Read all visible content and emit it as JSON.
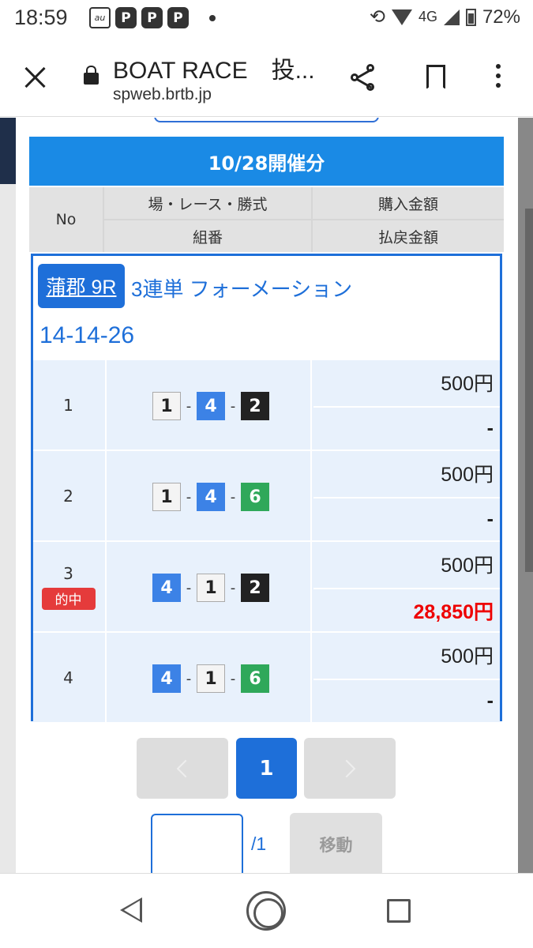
{
  "status_bar": {
    "time": "18:59",
    "carrier_icon": "au-icon",
    "app_icons": [
      "paypay-icon",
      "paypay-icon",
      "paypay-icon"
    ],
    "network": "4G",
    "battery": "72%"
  },
  "browser": {
    "title": "BOAT RACE　投...",
    "url": "spweb.brtb.jp"
  },
  "ticket_table": {
    "date_header": "10/28開催分",
    "headers": {
      "no": "No",
      "race": "場・レース・勝式",
      "amount": "購入金額",
      "combo": "組番",
      "payout": "払戻金額"
    },
    "bet": {
      "race": "蒲郡 9R",
      "type": "3連単 フォーメーション",
      "code": "14-14-26"
    },
    "rows": [
      {
        "no": "1",
        "combo": [
          "1",
          "4",
          "2"
        ],
        "amount": "500円",
        "payout": "-",
        "hit": false
      },
      {
        "no": "2",
        "combo": [
          "1",
          "4",
          "6"
        ],
        "amount": "500円",
        "payout": "-",
        "hit": false
      },
      {
        "no": "3",
        "combo": [
          "4",
          "1",
          "2"
        ],
        "amount": "500円",
        "payout": "28,850円",
        "hit": true,
        "hit_label": "的中"
      },
      {
        "no": "4",
        "combo": [
          "4",
          "1",
          "6"
        ],
        "amount": "500円",
        "payout": "-",
        "hit": false
      }
    ],
    "boat_colors": {
      "1": "#f4f4f4",
      "2": "#222222",
      "4": "#3c82e6",
      "6": "#2fa85a"
    }
  },
  "pagination": {
    "current": "1",
    "total": "/1",
    "move": "移動",
    "input_value": ""
  },
  "colors": {
    "header_blue": "#1a8ae5",
    "accent_blue": "#1e6fd9",
    "hit_red": "#e00000"
  }
}
